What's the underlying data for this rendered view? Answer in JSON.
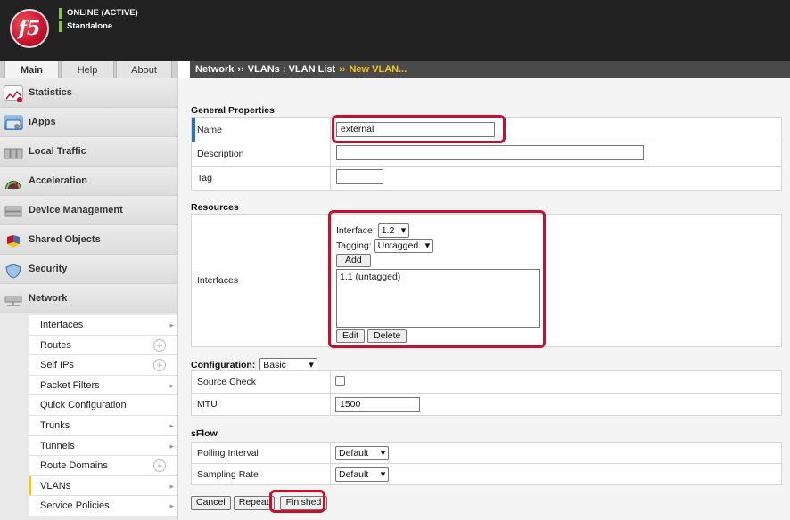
{
  "header": {
    "logo_text": "f5",
    "status": "ONLINE (ACTIVE)",
    "mode": "Standalone"
  },
  "tabs": [
    {
      "label": "Main"
    },
    {
      "label": "Help"
    },
    {
      "label": "About"
    }
  ],
  "breadcrumb": {
    "part1": "Network",
    "sep1": "››",
    "part2": "VLANs : VLAN List",
    "sep2": "››",
    "current": "New VLAN..."
  },
  "sidebar": {
    "items": [
      {
        "label": "Statistics",
        "icon": "statistics-icon"
      },
      {
        "label": "iApps",
        "icon": "iapps-icon"
      },
      {
        "label": "Local Traffic",
        "icon": "local-traffic-icon"
      },
      {
        "label": "Acceleration",
        "icon": "acceleration-icon"
      },
      {
        "label": "Device Management",
        "icon": "device-management-icon"
      },
      {
        "label": "Shared Objects",
        "icon": "shared-objects-icon"
      },
      {
        "label": "Security",
        "icon": "security-icon"
      },
      {
        "label": "Network",
        "icon": "network-icon"
      }
    ],
    "sub_items": [
      {
        "label": "Interfaces"
      },
      {
        "label": "Routes"
      },
      {
        "label": "Self IPs"
      },
      {
        "label": "Packet Filters"
      },
      {
        "label": "Quick Configuration"
      },
      {
        "label": "Trunks"
      },
      {
        "label": "Tunnels"
      },
      {
        "label": "Route Domains"
      },
      {
        "label": "VLANs"
      },
      {
        "label": "Service Policies"
      }
    ]
  },
  "general": {
    "title": "General Properties",
    "name_label": "Name",
    "name_value": "external",
    "description_label": "Description",
    "description_value": "",
    "tag_label": "Tag",
    "tag_value": ""
  },
  "resources": {
    "title": "Resources",
    "interfaces_label": "Interfaces",
    "interface_field_label": "Interface:",
    "interface_value": "1.2",
    "tagging_label": "Tagging:",
    "tagging_value": "Untagged",
    "add_label": "Add",
    "list_items": [
      "1.1 (untagged)"
    ],
    "edit_label": "Edit",
    "delete_label": "Delete"
  },
  "configuration": {
    "title": "Configuration:",
    "mode_value": "Basic",
    "source_check_label": "Source Check",
    "mtu_label": "MTU",
    "mtu_value": "1500"
  },
  "sflow": {
    "title": "sFlow",
    "polling_label": "Polling Interval",
    "polling_value": "Default",
    "sampling_label": "Sampling Rate",
    "sampling_value": "Default"
  },
  "actions": {
    "cancel": "Cancel",
    "repeat": "Repeat",
    "finished": "Finished"
  },
  "colors": {
    "highlight": "#c8102e",
    "active_marker": "#f5c518",
    "status_green": "#8bc34a"
  }
}
